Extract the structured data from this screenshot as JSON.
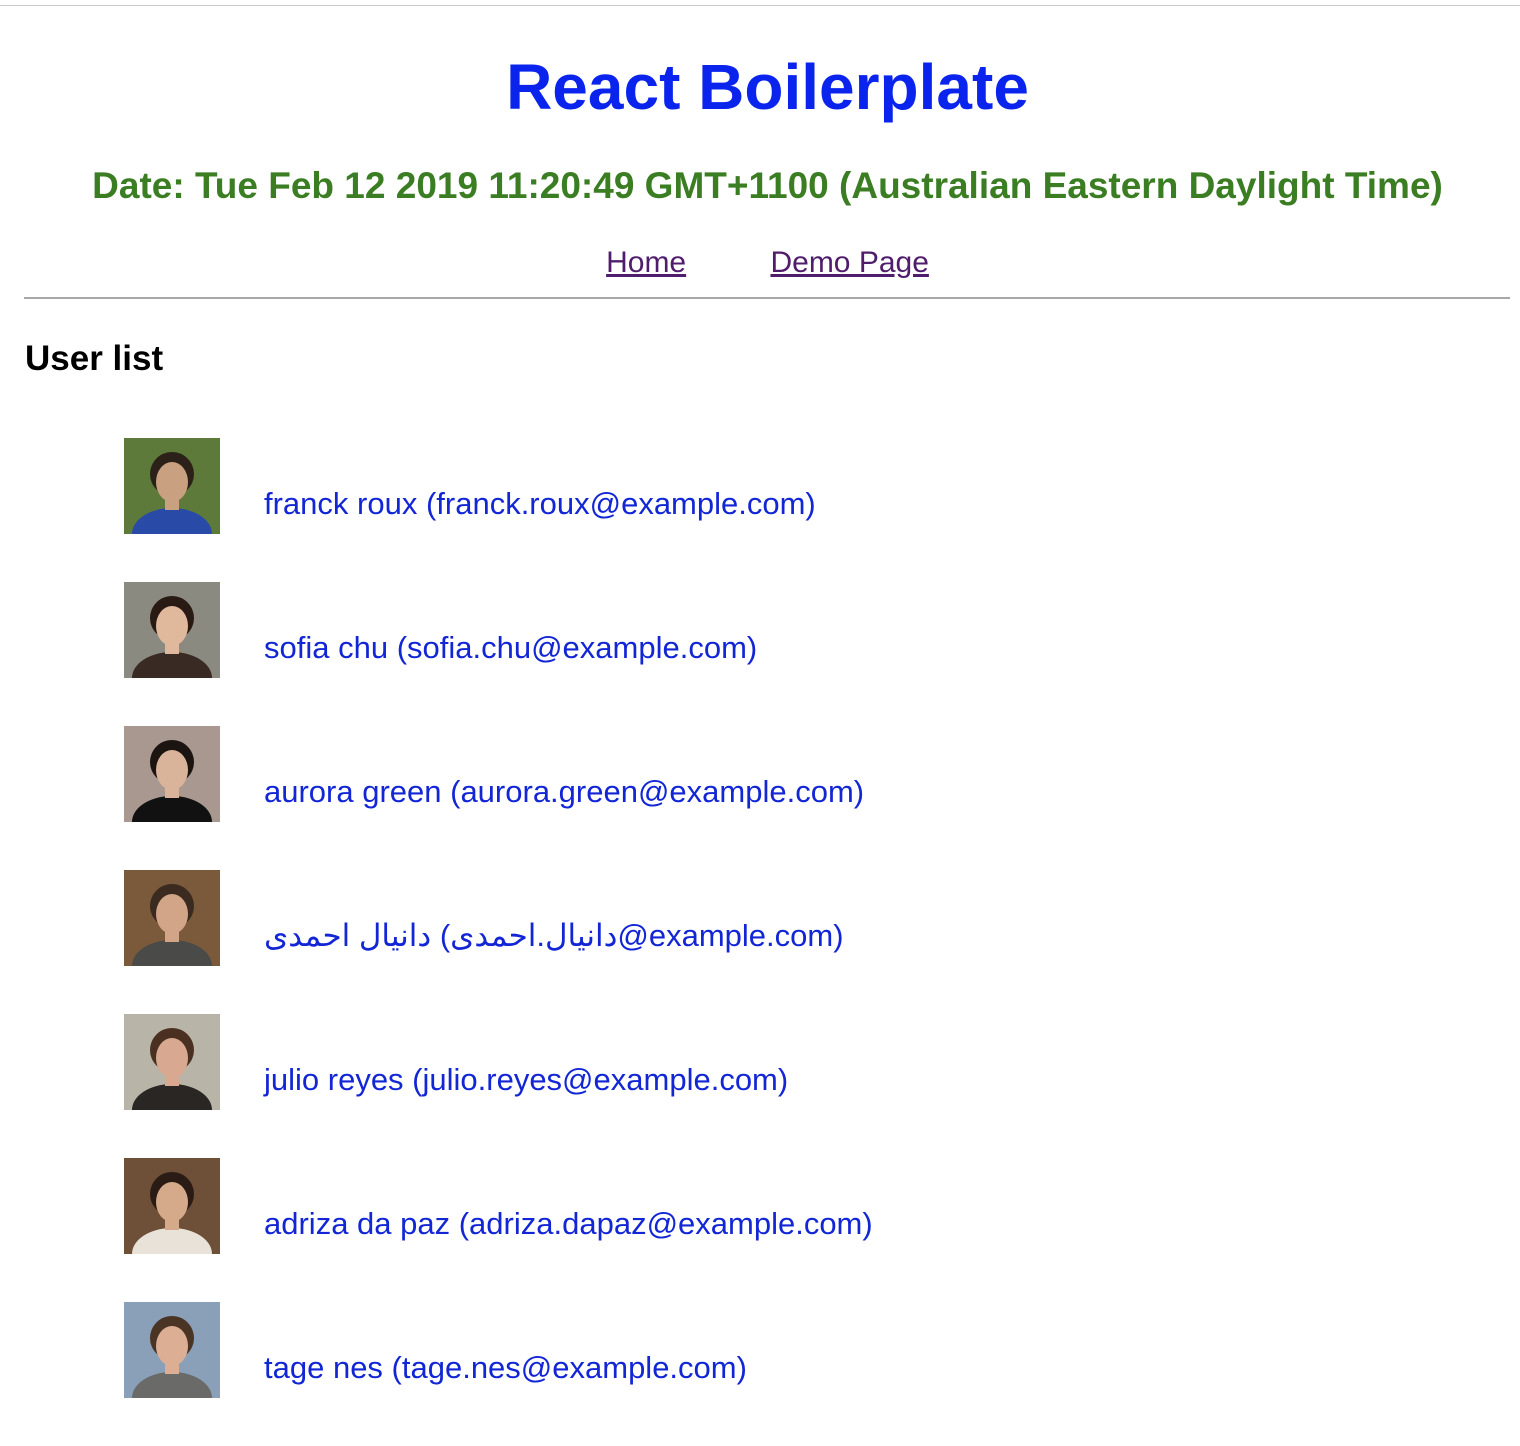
{
  "header": {
    "title": "React Boilerplate",
    "date_line": "Date: Tue Feb 12 2019 11:20:49 GMT+1100 (Australian Eastern Daylight Time)"
  },
  "nav": {
    "links": [
      {
        "label": "Home"
      },
      {
        "label": "Demo Page"
      }
    ]
  },
  "main": {
    "heading": "User list",
    "users": [
      {
        "label": "franck roux (franck.roux@example.com)",
        "avatar": {
          "background": "#5d7a3a",
          "skin": "#c9a080",
          "hair": "#2b2118",
          "shirt": "#2a4aa8"
        }
      },
      {
        "label": "sofia chu (sofia.chu@example.com)",
        "avatar": {
          "background": "#8a8a80",
          "skin": "#e0b89c",
          "hair": "#2a1a14",
          "shirt": "#3a2a24"
        }
      },
      {
        "label": "aurora green (aurora.green@example.com)",
        "avatar": {
          "background": "#a89890",
          "skin": "#d9b39a",
          "hair": "#1c1410",
          "shirt": "#111111"
        }
      },
      {
        "label": "دانیال احمدی (دانیال.احمدی@example.com)",
        "avatar": {
          "background": "#7a5a3a",
          "skin": "#d2a488",
          "hair": "#3a2a20",
          "shirt": "#4a4a48"
        }
      },
      {
        "label": "julio reyes (julio.reyes@example.com)",
        "avatar": {
          "background": "#b8b4a8",
          "skin": "#d8a890",
          "hair": "#4a3020",
          "shirt": "#2a2624"
        }
      },
      {
        "label": "adriza da paz (adriza.dapaz@example.com)",
        "avatar": {
          "background": "#6e5038",
          "skin": "#d4aa8a",
          "hair": "#2a1c14",
          "shirt": "#e8e2d8"
        }
      },
      {
        "label": "tage nes (tage.nes@example.com)",
        "avatar": {
          "background": "#8aa0b8",
          "skin": "#dcae94",
          "hair": "#4a3424",
          "shirt": "#6a6a68"
        }
      }
    ]
  }
}
